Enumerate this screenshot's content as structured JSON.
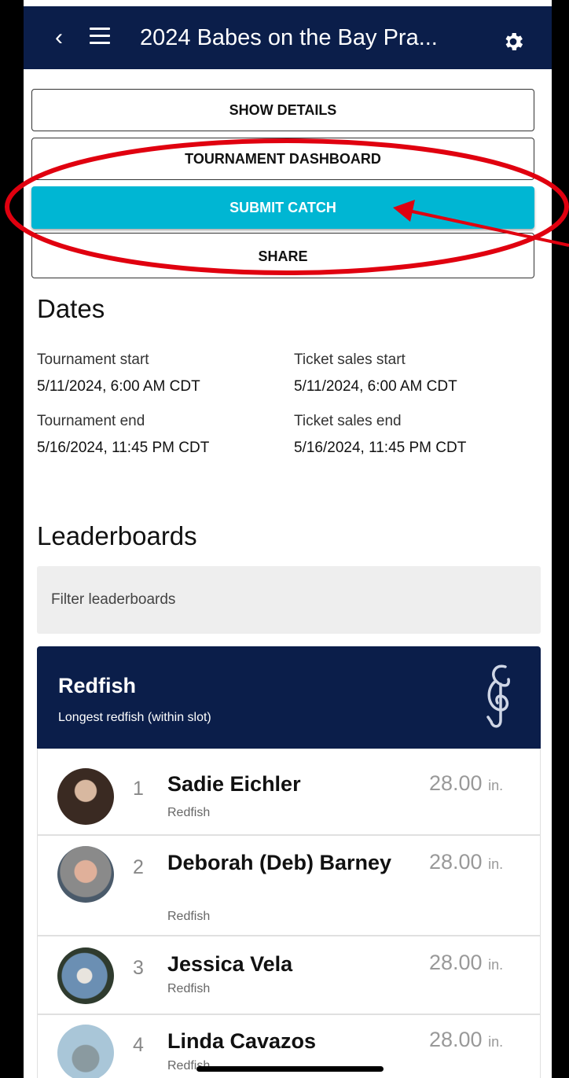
{
  "header": {
    "title": "2024 Babes on the Bay Pra..."
  },
  "buttons": {
    "show_details": "SHOW DETAILS",
    "tournament_dashboard": "TOURNAMENT DASHBOARD",
    "submit_catch": "SUBMIT CATCH",
    "share": "SHARE"
  },
  "dates": {
    "heading": "Dates",
    "tournament_start_label": "Tournament start",
    "tournament_start": "5/11/2024, 6:00 AM CDT",
    "tournament_end_label": "Tournament end",
    "tournament_end": "5/16/2024, 11:45 PM CDT",
    "ticket_start_label": "Ticket sales start",
    "ticket_start": "5/11/2024, 6:00 AM CDT",
    "ticket_end_label": "Ticket sales end",
    "ticket_end": "5/16/2024, 11:45 PM CDT"
  },
  "leaderboards": {
    "heading": "Leaderboards",
    "filter_placeholder": "Filter leaderboards",
    "board": {
      "name": "Redfish",
      "subtitle": "Longest redfish (within slot)",
      "entries": [
        {
          "rank": "1",
          "name": "Sadie Eichler",
          "species": "Redfish",
          "score": "28.00",
          "unit": "in."
        },
        {
          "rank": "2",
          "name": "Deborah (Deb) Barney",
          "species": "Redfish",
          "score": "28.00",
          "unit": "in."
        },
        {
          "rank": "3",
          "name": "Jessica Vela",
          "species": "Redfish",
          "score": "28.00",
          "unit": "in."
        },
        {
          "rank": "4",
          "name": "Linda Cavazos",
          "species": "Redfish",
          "score": "28.00",
          "unit": "in."
        }
      ]
    }
  },
  "colors": {
    "navy": "#0b1e4a",
    "accent": "#00b6d3",
    "annotation": "#e0000f"
  }
}
